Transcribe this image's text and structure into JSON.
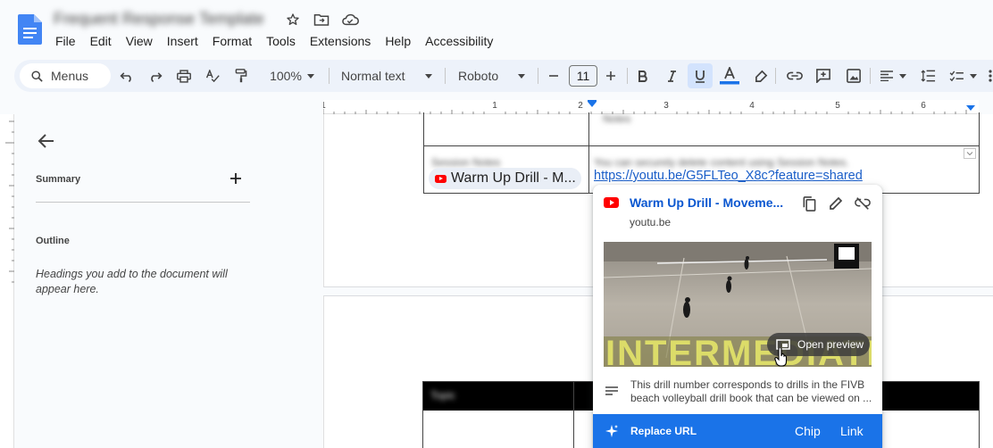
{
  "app": {
    "doc_title": "Frequent Response Template",
    "menu": [
      "File",
      "Edit",
      "View",
      "Insert",
      "Format",
      "Tools",
      "Extensions",
      "Help",
      "Accessibility"
    ]
  },
  "toolbar": {
    "menus_search": "Menus",
    "zoom": "100%",
    "style": "Normal text",
    "font": "Roboto",
    "font_size": "11",
    "colors": {
      "text_color_bar": "#1a73e8",
      "active_bg": "#d3e3fd"
    }
  },
  "ruler": {
    "marks": [
      "1",
      "1",
      "2",
      "3",
      "4",
      "5",
      "6"
    ]
  },
  "sidebar": {
    "summary_label": "Summary",
    "outline_label": "Outline",
    "outline_hint": "Headings you add to the document will appear here."
  },
  "document": {
    "chip_label": "Warm Up Drill - M...",
    "link_url": "https://youtu.be/G5FLTeo_X8c?feature=shared",
    "blurred_cell_1": "Session Notes",
    "blurred_cell_2": "You can securely delete content using Session Notes.",
    "blurred_header": "Topic"
  },
  "popup": {
    "title": "Warm Up Drill - Moveme...",
    "domain": "youtu.be",
    "thumbnail_caption": "Intermediate",
    "open_preview": "Open preview",
    "description": "This drill number corresponds to drills in the FIVB beach volleyball drill book that can be viewed on ...",
    "replace_url": "Replace URL",
    "chip_button": "Chip",
    "link_button": "Link",
    "accent_color": "#1a73e8"
  }
}
